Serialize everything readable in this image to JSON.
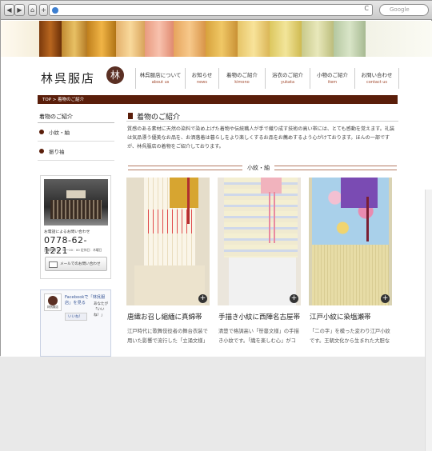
{
  "browser": {
    "back": "◀",
    "forward": "▶",
    "home": "⌂",
    "add": "+",
    "reload": "C",
    "search_placeholder": "Google"
  },
  "site": {
    "name": "林呉服店",
    "logo_char": "林"
  },
  "nav": [
    {
      "ja": "林呉服店について",
      "en": "about us"
    },
    {
      "ja": "お知らせ",
      "en": "news"
    },
    {
      "ja": "着物のご紹介",
      "en": "kimono"
    },
    {
      "ja": "浴衣のご紹介",
      "en": "yukata"
    },
    {
      "ja": "小物のご紹介",
      "en": "item"
    },
    {
      "ja": "お問い合わせ",
      "en": "contact us"
    }
  ],
  "breadcrumb": "TOP > 着物のご紹介",
  "sidebar": {
    "heading": "着物のご紹介",
    "items": [
      "小紋・紬",
      "振り袖"
    ],
    "contact_label": "お電話によるお問い合わせ",
    "phone": "0778-62-1221",
    "hours": "営業時間 8：30〜20：00  定休日：木曜日",
    "mail_button": "メールでのお問い合わせ",
    "fb_text": "Facebookで「林呉服店」を見る",
    "fb_logo": "林呉服店",
    "like": "いいね！",
    "fb_body": "あなたが「いいね！」"
  },
  "main": {
    "heading": "着物のご紹介",
    "intro": "質感のある素材に天然の染料で染め上げた着物や伝統職人が手で織り成す技術の高い帯には、とても感動を覚えます。礼装は気品漂う優美なお品を、お洒落着は暮らしをより楽しくするお品をお薦めするよう心がけております。ほんの一部ですが、林呉服店の着物をご紹介しております。",
    "section": "小紋・紬",
    "cards": [
      {
        "title": "唐織お召し縮緬に真綿帯",
        "desc": "江戸時代に歌舞伎役者の舞台衣装で用いた影響で流行した「立涌文様」"
      },
      {
        "title": "手描き小紋に西陣名古屋帯",
        "desc": "清楚で格調高い「笹蔓文様」の手描き小紋です。「織を楽しむ心」がコ"
      },
      {
        "title": "江戸小紋に染塩瀬帯",
        "desc": "「二の字」を模った変わり江戸小紋です。王朝文化から生まれた大胆な"
      }
    ]
  }
}
